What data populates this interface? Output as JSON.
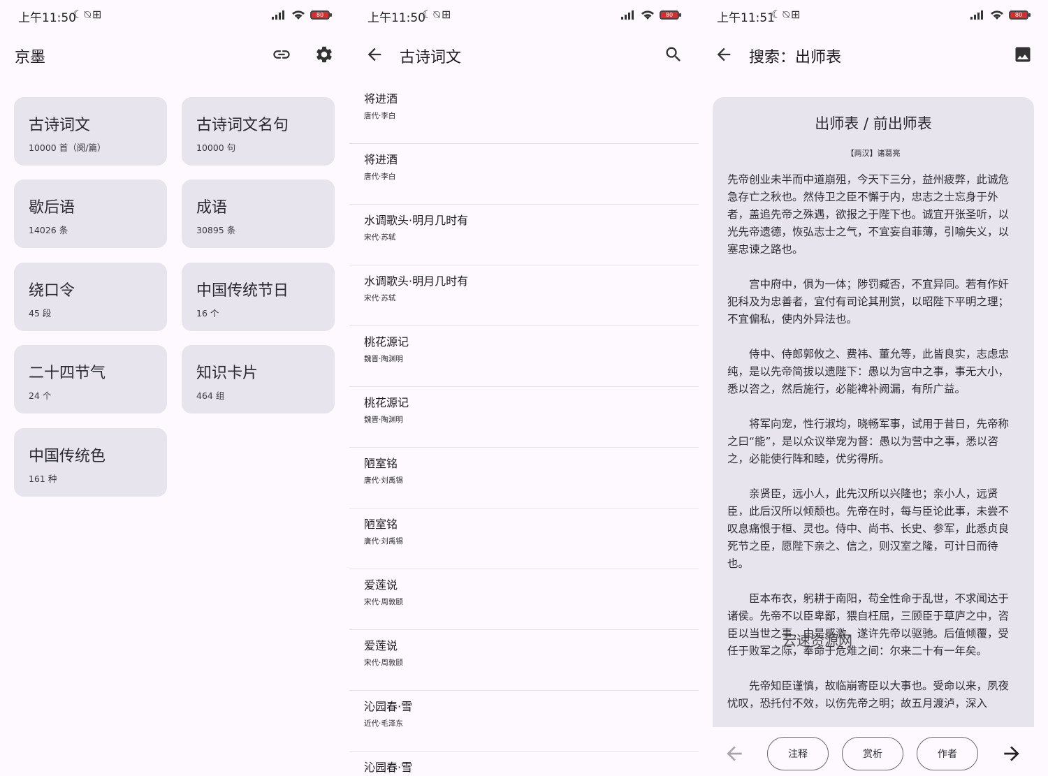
{
  "screens": [
    {
      "status": {
        "time": "上午11:50",
        "glyphs": "☾⍉⊞",
        "battery": "80"
      },
      "appbar": {
        "title": "京墨"
      },
      "cards": [
        {
          "name": "古诗词文",
          "count": "10000 首（阕/篇）"
        },
        {
          "name": "古诗词文名句",
          "count": "10000 句"
        },
        {
          "name": "歇后语",
          "count": "14026 条"
        },
        {
          "name": "成语",
          "count": "30895 条"
        },
        {
          "name": "绕口令",
          "count": "45 段"
        },
        {
          "name": "中国传统节日",
          "count": "16 个"
        },
        {
          "name": "二十四节气",
          "count": "24 个"
        },
        {
          "name": "知识卡片",
          "count": "464 组"
        },
        {
          "name": "中国传统色",
          "count": "161 种"
        }
      ]
    },
    {
      "status": {
        "time": "上午11:50",
        "glyphs": "☾⍉⊞",
        "battery": "80"
      },
      "appbar": {
        "title": "古诗词文"
      },
      "items": [
        {
          "title": "将进酒",
          "author": "唐代·李白"
        },
        {
          "title": "将进酒",
          "author": "唐代·李白"
        },
        {
          "title": "水调歌头·明月几时有",
          "author": "宋代·苏轼"
        },
        {
          "title": "水调歌头·明月几时有",
          "author": "宋代·苏轼"
        },
        {
          "title": "桃花源记",
          "author": "魏晋·陶渊明"
        },
        {
          "title": "桃花源记",
          "author": "魏晋·陶渊明"
        },
        {
          "title": "陋室铭",
          "author": "唐代·刘禹锡"
        },
        {
          "title": "陋室铭",
          "author": "唐代·刘禹锡"
        },
        {
          "title": "爱莲说",
          "author": "宋代·周敦颐"
        },
        {
          "title": "爱莲说",
          "author": "宋代·周敦颐"
        },
        {
          "title": "沁园春·雪",
          "author": "近代·毛泽东"
        },
        {
          "title": "沁园春·雪",
          "author": ""
        }
      ]
    },
    {
      "status": {
        "time": "上午11:51",
        "glyphs": "☾⍉⊞",
        "battery": "80"
      },
      "appbar": {
        "title": "搜索：出师表"
      },
      "poem": {
        "title": "出师表 / 前出师表",
        "author": "【两汉】诸葛亮",
        "paragraphs": [
          "先帝创业未半而中道崩殂，今天下三分，益州疲弊，此诚危急存亡之秋也。然侍卫之臣不懈于内，忠志之士忘身于外者，盖追先帝之殊遇，欲报之于陛下也。诚宜开张圣听，以光先帝遗德，恢弘志士之气，不宜妄自菲薄，引喻失义，以塞忠谏之路也。",
          "　　宫中府中，俱为一体；陟罚臧否，不宜异同。若有作奸犯科及为忠善者，宜付有司论其刑赏，以昭陛下平明之理；不宜偏私，使内外异法也。",
          "　　侍中、侍郎郭攸之、费祎、董允等，此皆良实，志虑忠纯，是以先帝简拔以遗陛下：愚以为宫中之事，事无大小，悉以咨之，然后施行，必能裨补阙漏，有所广益。",
          "　　将军向宠，性行淑均，晓畅军事，试用于昔日，先帝称之曰“能”，是以众议举宠为督：愚以为营中之事，悉以咨之，必能使行阵和睦，优劣得所。",
          "　　亲贤臣，远小人，此先汉所以兴隆也；亲小人，远贤臣，此后汉所以倾颓也。先帝在时，每与臣论此事，未尝不叹息痛恨于桓、灵也。侍中、尚书、长史、参军，此悉贞良死节之臣，愿陛下亲之、信之，则汉室之隆，可计日而待也。",
          "　　臣本布衣，躬耕于南阳，苟全性命于乱世，不求闻达于诸侯。先帝不以臣卑鄙，猥自枉屈，三顾臣于草庐之中，咨臣以当世之事，由是感激，遂许先帝以驱驰。后值倾覆，受任于败军之际，奉命于危难之间：尔来二十有一年矣。",
          "　　先帝知臣谨慎，故临崩寄臣以大事也。受命以来，夙夜忧叹，恐托付不效，以伤先帝之明；故五月渡泸，深入"
        ]
      },
      "watermark": "云速资源网",
      "buttons": {
        "notes": "注释",
        "analysis": "赏析",
        "author": "作者"
      }
    }
  ]
}
